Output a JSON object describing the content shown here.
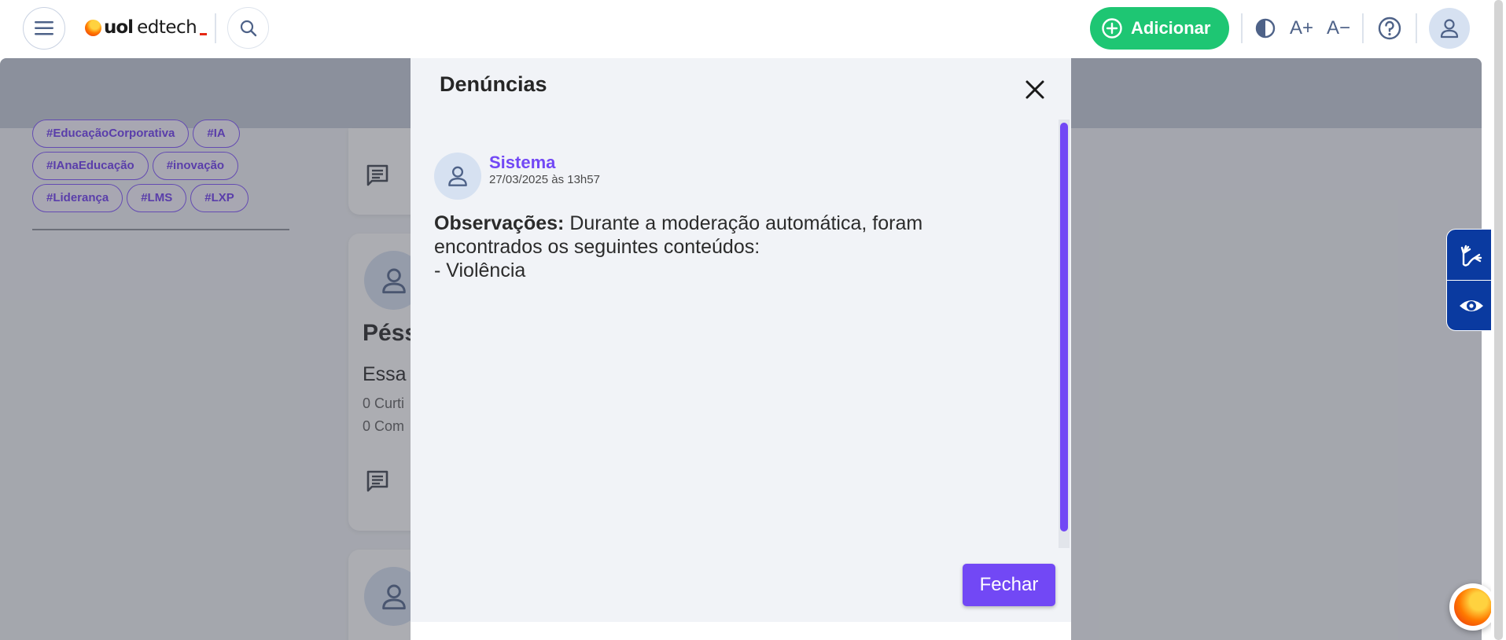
{
  "header": {
    "logo_brand": "uol",
    "logo_product": "edtech",
    "add_label": "Adicionar",
    "font_increase": "A+",
    "font_decrease": "A−",
    "accent_color": "#1ec673"
  },
  "background": {
    "tags": [
      [
        "#EducaçãoCorporativa",
        "#IA"
      ],
      [
        "#IAnaEducação",
        "#inovação"
      ],
      [
        "#Liderança",
        "#LMS",
        "#LXP"
      ]
    ],
    "post": {
      "title": "Péss",
      "text": "Essa",
      "likes": "0 Curti",
      "comments": "0 Com"
    }
  },
  "modal": {
    "title": "Denúncias",
    "author": {
      "name": "Sistema",
      "date": "27/03/2025 às 13h57"
    },
    "observations": {
      "label": "Observações:",
      "text_line1": "Durante a moderação automática, foram",
      "text_line2": "encontrados os seguintes conteúdos:",
      "text_line3": "- Violência"
    },
    "close_button": "Fechar",
    "accent_color": "#7248f5"
  }
}
